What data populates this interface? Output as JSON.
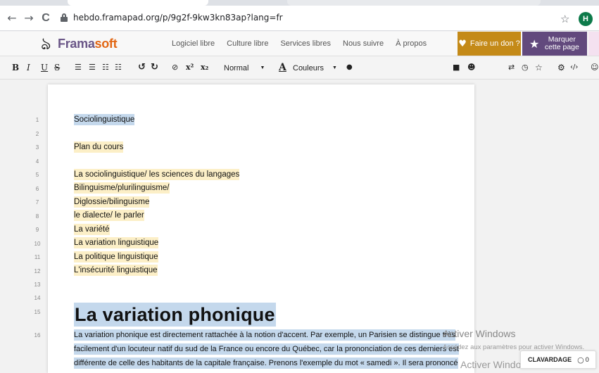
{
  "browser": {
    "url": "hebdo.framapad.org/p/9g2f-9kw3kn83ap?lang=fr",
    "back_icon": "←",
    "forward_icon": "→",
    "reload_icon": "C",
    "bookmark_icon": "☆",
    "profile_initial": "H"
  },
  "framanav": {
    "logo_prefix": "Frama",
    "logo_suffix": "soft",
    "links": [
      "Logiciel libre",
      "Culture libre",
      "Services libres",
      "Nous suivre",
      "À propos"
    ],
    "donate_label": "Faire un don ?",
    "bookmark_label_1": "Marquer",
    "bookmark_label_2": "cette page",
    "accent_donate": "#c48a18",
    "accent_purple": "#62497d"
  },
  "toolbar": {
    "bold": "B",
    "italic": "I",
    "underline": "U",
    "strike": "S",
    "style_select": "Normal",
    "color_letter": "A",
    "color_select": "Couleurs"
  },
  "document": {
    "line_numbers": [
      "1",
      "2",
      "3",
      "4",
      "5",
      "6",
      "7",
      "8",
      "9",
      "10",
      "11",
      "12",
      "13",
      "14",
      "15",
      "16"
    ],
    "line1": "Sociolinguistique",
    "line3": "Plan du cours",
    "outline": [
      "La sociolinguistique/ les sciences du langages",
      "Bilinguisme/plurilinguisme/",
      "Diglossie/bilinguisme",
      "le dialecte/ le parler",
      "La variété",
      "La variation linguistique",
      "La politique linguistique",
      "L'insécurité linguistique"
    ],
    "heading": "La variation phonique",
    "paragraph": [
      "La variation phonique est directement rattachée à la notion d'accent. Par exemple, un Parisien se distingue très",
      "facilement d'un locuteur natif du sud de la France ou encore du Québec, car la prononciation de ces derniers est",
      "différente de celle des habitants de la capitale française. Prenons l'exemple du mot « samedi ». Il sera prononcé"
    ]
  },
  "overlay": {
    "activate_title": "Activer Windows",
    "activate_sub": "Accédez aux paramètres pour activer Windows.",
    "activate_ghost": "Activer Windows",
    "chat_label": "CLAVARDAGE",
    "chat_count": "0"
  }
}
